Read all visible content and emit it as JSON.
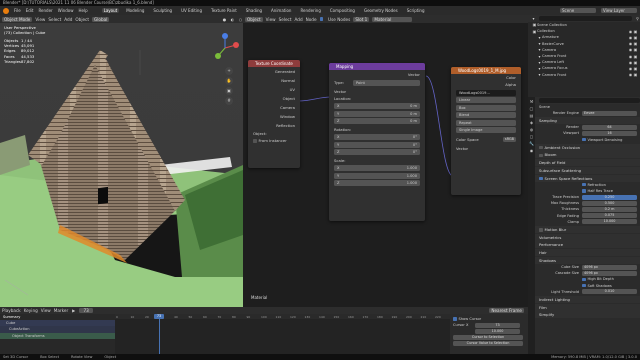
{
  "window": {
    "title": "Blender* [D:\\TUTORIALS\\2021 11 06 Blender Course\\BC\\zbudika 1_6.blend]"
  },
  "menu": [
    "File",
    "Edit",
    "Render",
    "Window",
    "Help"
  ],
  "workspaces": [
    "Layout",
    "Modeling",
    "Sculpting",
    "UV Editing",
    "Texture Paint",
    "Shading",
    "Animation",
    "Rendering",
    "Compositing",
    "Geometry Nodes",
    "Scripting"
  ],
  "active_workspace": "Layout",
  "scene": {
    "label": "Scene",
    "view_layer": "View Layer"
  },
  "viewport": {
    "mode": "Object Mode",
    "menus": [
      "View",
      "Select",
      "Add",
      "Object"
    ],
    "transform": "Global",
    "info_line1": "User Perspective",
    "info_line2": "(73) Collection | Cube",
    "stats": [
      {
        "key": "Objects",
        "value": "1 / 44"
      },
      {
        "key": "Vertices",
        "value": "45,091"
      },
      {
        "key": "Edges",
        "value": "89,012"
      },
      {
        "key": "Faces",
        "value": "44,533"
      },
      {
        "key": "Triangles",
        "value": "87,802"
      }
    ]
  },
  "node_editor": {
    "type": "Object",
    "menus": [
      "View",
      "Select",
      "Add",
      "Node"
    ],
    "use_nodes": "Use Nodes",
    "slot": "Slot 1",
    "material": "Material",
    "footer_label": "Material",
    "tex_coord": {
      "title": "Texture Coordinate",
      "outputs": [
        "Generated",
        "Normal",
        "UV",
        "Object",
        "Camera",
        "Window",
        "Reflection"
      ],
      "object_label": "Object:",
      "from_instancer": "From Instancer"
    },
    "mapping": {
      "title": "Mapping",
      "output": "Vector",
      "type_label": "Type:",
      "type_value": "Point",
      "vector": "Vector",
      "location_label": "Location:",
      "location": [
        {
          "axis": "X",
          "val": "0 m"
        },
        {
          "axis": "Y",
          "val": "0 m"
        },
        {
          "axis": "Z",
          "val": "0 m"
        }
      ],
      "rotation_label": "Rotation:",
      "rotation": [
        {
          "axis": "X",
          "val": "0°"
        },
        {
          "axis": "Y",
          "val": "0°"
        },
        {
          "axis": "Z",
          "val": "0°"
        }
      ],
      "scale_label": "Scale:",
      "scale": [
        {
          "axis": "X",
          "val": "1.000"
        },
        {
          "axis": "Y",
          "val": "1.000"
        },
        {
          "axis": "Z",
          "val": "1.000"
        }
      ]
    },
    "image_tex": {
      "title": "WoodLogs0019_1_M.jpg",
      "out_color": "Color",
      "out_alpha": "Alpha",
      "image_name": "WoodLogs0019...",
      "interp": "Linear",
      "proj": "Box",
      "blend": "Blend",
      "ext": "Repeat",
      "source": "Single Image",
      "color_space_label": "Color Space",
      "color_space_value": "sRGB",
      "vector": "Vector"
    }
  },
  "outliner": {
    "root": "Scene Collection",
    "items": [
      {
        "name": "Collection",
        "indent": 0
      },
      {
        "name": "Armature",
        "indent": 1
      },
      {
        "name": "BezierCurve",
        "indent": 1
      },
      {
        "name": "Camera",
        "indent": 1
      },
      {
        "name": "Camera Front",
        "indent": 1
      },
      {
        "name": "Camera Left",
        "indent": 1
      },
      {
        "name": "Camera Focus",
        "indent": 1
      },
      {
        "name": "Camera Front",
        "indent": 1
      }
    ]
  },
  "properties": {
    "header": "Scene",
    "render_engine_label": "Render Engine",
    "render_engine": "Eevee",
    "sampling": "Sampling",
    "render_label": "Render",
    "render_val": "64",
    "viewport_label": "Viewport",
    "viewport_val": "16",
    "viewport_denoise": "Viewport Denoising",
    "ao": "Ambient Occlusion",
    "bloom": "Bloom",
    "dof": "Depth of Field",
    "sss": "Subsurface Scattering",
    "ssr": "Screen Space Reflections",
    "refraction": "Refraction",
    "half_res": "Half Res Trace",
    "trace_precision_label": "Trace Precision",
    "trace_precision": "0.250",
    "max_roughness_label": "Max Roughness",
    "max_roughness": "0.500",
    "thickness_label": "Thickness",
    "thickness": "0.2 m",
    "edge_fading_label": "Edge Fading",
    "edge_fading": "0.075",
    "clamp_label": "Clamp",
    "clamp": "10.000",
    "motion_blur": "Motion Blur",
    "volumetrics": "Volumetrics",
    "performance": "Performance",
    "hair": "Hair",
    "shadows": "Shadows",
    "cube_size_label": "Cube Size",
    "cube_size": "4096 px",
    "cascade_label": "Cascade Size",
    "cascade": "4096 px",
    "high_bit": "High Bit Depth",
    "soft_shadows": "Soft Shadows",
    "light_threshold_label": "Light Threshold",
    "light_threshold": "0.010",
    "indirect": "Indirect Lighting",
    "film": "Film",
    "simplify": "Simplify"
  },
  "timeline": {
    "menus": [
      "Playback",
      "Keying",
      "View",
      "Marker"
    ],
    "summary": "Summary",
    "rows": [
      "Cube",
      "CubeAction",
      "Object Transforms"
    ],
    "ticks": [
      "0",
      "10",
      "20",
      "30",
      "40",
      "50",
      "60",
      "70",
      "80",
      "90",
      "100",
      "110",
      "120",
      "130",
      "140",
      "150",
      "160",
      "170",
      "180",
      "190",
      "200",
      "210",
      "220"
    ],
    "current_frame": "73",
    "keyframes": "Nearest Frame",
    "show_cursor": "Show Cursor",
    "cursor_x_label": "Cursor X",
    "cursor_x": "73",
    "cursor_y": "10.000",
    "cursor_btn1": "Cursor to Selection",
    "cursor_btn2": "Cursor Value to Selection"
  },
  "status": {
    "left": "Set 3D Cursor",
    "mid1": "Box Select",
    "mid2": "Rotate View",
    "mid3": "Object",
    "right": "Memory: 590.8 MiB | VRAM: 1.0/12.0 GiB | 3.0.0"
  }
}
